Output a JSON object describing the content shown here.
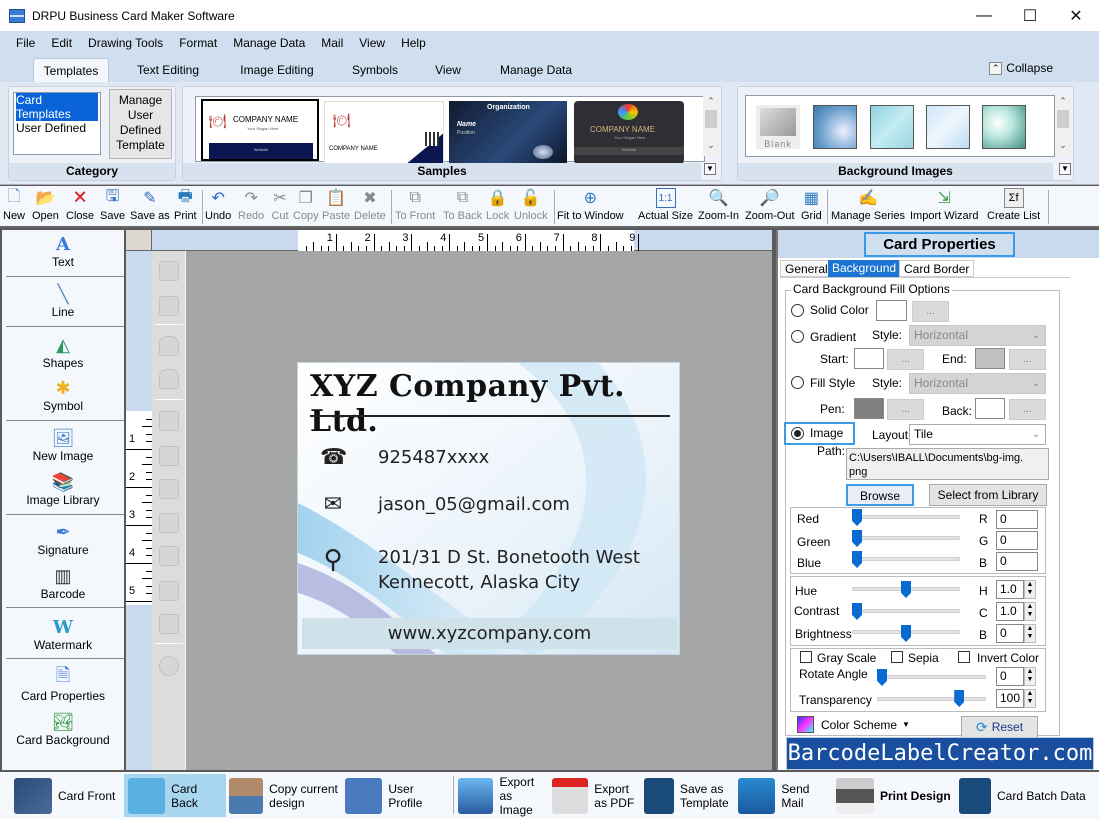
{
  "window": {
    "title": "DRPU Business Card Maker Software",
    "controls": {
      "minimize": "—",
      "maximize": "☐",
      "close": "✕"
    }
  },
  "menu": [
    "File",
    "Edit",
    "Drawing Tools",
    "Format",
    "Manage Data",
    "Mail",
    "View",
    "Help"
  ],
  "ribbon_tabs": {
    "items": [
      "Templates",
      "Text Editing",
      "Image Editing",
      "Symbols",
      "View",
      "Manage Data"
    ],
    "active": "Templates",
    "collapse_label": "Collapse"
  },
  "ribbon": {
    "category": {
      "label": "Category",
      "list": [
        "Card Templates",
        "User Defined"
      ],
      "selected": "Card Templates",
      "manage_button": "Manage User Defined Template"
    },
    "samples": {
      "label": "Samples",
      "thumbs": [
        {
          "title": "COMPANY NAME",
          "sub": "Your Slogan Here",
          "footer": "Website"
        },
        {
          "title": "COMPANY NAME",
          "sub": "",
          "footer": ""
        },
        {
          "title": "Organization",
          "sub": "Name",
          "footer": "Position"
        },
        {
          "title": "COMPANY NAME",
          "sub": "Your Slogan Here",
          "footer": "Website"
        }
      ]
    },
    "background_images": {
      "label": "Background Images",
      "thumbs": [
        "Blank",
        "bg-blue-swirl",
        "bg-teal-grid",
        "bg-light-blue",
        "bg-green-glow"
      ]
    }
  },
  "toolbar": [
    {
      "label": "New",
      "icon": "new-file-icon",
      "enabled": true
    },
    {
      "label": "Open",
      "icon": "open-folder-icon",
      "enabled": true
    },
    {
      "label": "Close",
      "icon": "close-file-icon",
      "enabled": true
    },
    {
      "label": "Save",
      "icon": "save-icon",
      "enabled": true
    },
    {
      "label": "Save as",
      "icon": "save-as-icon",
      "enabled": true
    },
    {
      "label": "Print",
      "icon": "print-icon",
      "enabled": true
    },
    {
      "label": "Undo",
      "icon": "undo-icon",
      "enabled": true
    },
    {
      "label": "Redo",
      "icon": "redo-icon",
      "enabled": false
    },
    {
      "label": "Cut",
      "icon": "cut-icon",
      "enabled": false
    },
    {
      "label": "Copy",
      "icon": "copy-icon",
      "enabled": false
    },
    {
      "label": "Paste",
      "icon": "paste-icon",
      "enabled": false
    },
    {
      "label": "Delete",
      "icon": "delete-icon",
      "enabled": false
    },
    {
      "label": "To Front",
      "icon": "to-front-icon",
      "enabled": false
    },
    {
      "label": "To Back",
      "icon": "to-back-icon",
      "enabled": false
    },
    {
      "label": "Lock",
      "icon": "lock-icon",
      "enabled": false
    },
    {
      "label": "Unlock",
      "icon": "unlock-icon",
      "enabled": false
    },
    {
      "label": "Fit to Window",
      "icon": "fit-window-icon",
      "enabled": true
    },
    {
      "label": "Actual Size",
      "icon": "actual-size-icon",
      "enabled": true
    },
    {
      "label": "Zoom-In",
      "icon": "zoom-in-icon",
      "enabled": true
    },
    {
      "label": "Zoom-Out",
      "icon": "zoom-out-icon",
      "enabled": true
    },
    {
      "label": "Grid",
      "icon": "grid-icon",
      "enabled": true
    },
    {
      "label": "Manage Series",
      "icon": "manage-series-icon",
      "enabled": true
    },
    {
      "label": "Import Wizard",
      "icon": "import-wizard-icon",
      "enabled": true
    },
    {
      "label": "Create List",
      "icon": "create-list-icon",
      "enabled": true
    }
  ],
  "left_panel": [
    {
      "label": "Text",
      "icon": "text-icon"
    },
    {
      "label": "Line",
      "icon": "line-icon"
    },
    {
      "label": "Shapes",
      "icon": "shapes-icon"
    },
    {
      "label": "Symbol",
      "icon": "symbol-icon"
    },
    {
      "label": "New Image",
      "icon": "new-image-icon"
    },
    {
      "label": "Image Library",
      "icon": "image-library-icon"
    },
    {
      "label": "Signature",
      "icon": "signature-icon"
    },
    {
      "label": "Barcode",
      "icon": "barcode-icon"
    },
    {
      "label": "Watermark",
      "icon": "watermark-icon"
    },
    {
      "label": "Card Properties",
      "icon": "card-properties-icon"
    },
    {
      "label": "Card Background",
      "icon": "card-background-icon"
    }
  ],
  "rulers": {
    "horizontal": [
      "1",
      "2",
      "3",
      "4",
      "5",
      "6",
      "7",
      "8",
      "9"
    ],
    "vertical": [
      "1",
      "2",
      "3",
      "4",
      "5"
    ]
  },
  "card": {
    "company": "XYZ Company Pvt. Ltd.",
    "phone": "925487xxxx",
    "email": "jason_05@gmail.com",
    "address_line1": "201/31 D St. Bonetooth West",
    "address_line2": "Kennecott, Alaska City",
    "website": "www.xyzcompany.com"
  },
  "card_properties": {
    "title": "Card Properties",
    "tabs": [
      "General",
      "Background",
      "Card Border"
    ],
    "active_tab": "Background",
    "group_label": "Card Background Fill Options",
    "solid_color": {
      "label": "Solid Color",
      "color": "#ffffff",
      "button": "..."
    },
    "gradient": {
      "label": "Gradient",
      "style_label": "Style:",
      "style": "Horizontal",
      "start_label": "Start:",
      "start_color": "#ffffff",
      "end_label": "End:",
      "end_color": "#c0c0c0",
      "button": "..."
    },
    "fill_style": {
      "label": "Fill Style",
      "style_label": "Style:",
      "style": "Horizontal",
      "pen_label": "Pen:",
      "pen_color": "#808080",
      "back_label": "Back:",
      "back_color": "#ffffff",
      "button": "..."
    },
    "image": {
      "label": "Image",
      "selected": true,
      "layout_label": "Layout:",
      "layout": "Tile",
      "path_label": "Path:",
      "path": "C:\\Users\\IBALL\\Documents\\bg-img.png",
      "browse": "Browse",
      "select_library": "Select from Library"
    },
    "rgb": {
      "red": {
        "label": "Red",
        "short": "R",
        "value": "0"
      },
      "green": {
        "label": "Green",
        "short": "G",
        "value": "0"
      },
      "blue": {
        "label": "Blue",
        "short": "B",
        "value": "0"
      }
    },
    "adjust": {
      "hue": {
        "label": "Hue",
        "short": "H",
        "value": "1.0",
        "level": 0.5
      },
      "contrast": {
        "label": "Contrast",
        "short": "C",
        "value": "1.0",
        "level": 0.0
      },
      "brightness": {
        "label": "Brightness",
        "short": "B",
        "value": "0",
        "level": 0.5
      }
    },
    "effects": {
      "gray_scale": {
        "label": "Gray Scale",
        "checked": false
      },
      "sepia": {
        "label": "Sepia",
        "checked": false
      },
      "invert": {
        "label": "Invert Color",
        "checked": false
      },
      "rotate": {
        "label": "Rotate Angle",
        "value": "0",
        "level": 0.0
      },
      "transparency": {
        "label": "Transparency",
        "value": "100",
        "level": 0.78
      }
    },
    "color_scheme": "Color Scheme",
    "reset": "Reset"
  },
  "watermark_text": "BarcodeLabelCreator.com",
  "bottom_bar": [
    {
      "label": "Card Front",
      "icon": "card-front-icon"
    },
    {
      "label": "Card Back",
      "icon": "card-back-icon",
      "active": true
    },
    {
      "label": "Copy current design",
      "icon": "copy-design-icon"
    },
    {
      "label": "User Profile",
      "icon": "user-profile-icon"
    },
    {
      "label": "Export as Image",
      "icon": "export-image-icon"
    },
    {
      "label": "Export as PDF",
      "icon": "export-pdf-icon"
    },
    {
      "label": "Save as Template",
      "icon": "save-template-icon"
    },
    {
      "label": "Send Mail",
      "icon": "send-mail-icon"
    },
    {
      "label": "Print Design",
      "icon": "print-design-icon"
    },
    {
      "label": "Card Batch Data",
      "icon": "card-batch-data-icon"
    }
  ]
}
